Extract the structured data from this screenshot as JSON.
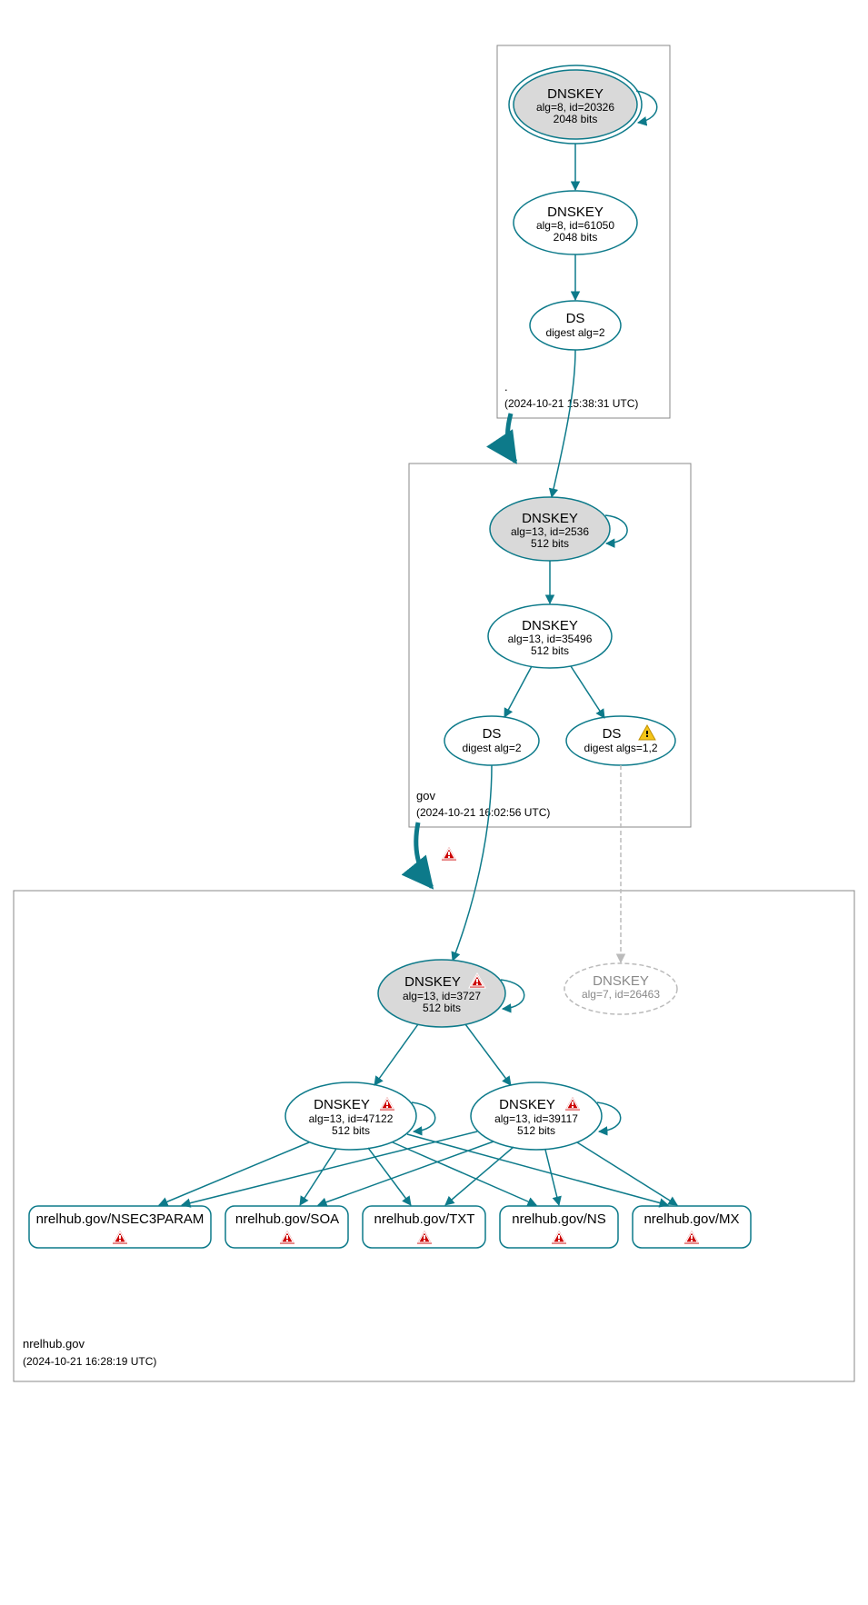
{
  "zones": {
    "root": {
      "label": ".",
      "timestamp": "(2024-10-21 15:38:31 UTC)"
    },
    "gov": {
      "label": "gov",
      "timestamp": "(2024-10-21 16:02:56 UTC)"
    },
    "nrelhub": {
      "label": "nrelhub.gov",
      "timestamp": "(2024-10-21 16:28:19 UTC)"
    }
  },
  "nodes": {
    "root_ksk": {
      "title": "DNSKEY",
      "line1": "alg=8, id=20326",
      "line2": "2048 bits"
    },
    "root_zsk": {
      "title": "DNSKEY",
      "line1": "alg=8, id=61050",
      "line2": "2048 bits"
    },
    "root_ds": {
      "title": "DS",
      "line1": "digest alg=2"
    },
    "gov_ksk": {
      "title": "DNSKEY",
      "line1": "alg=13, id=2536",
      "line2": "512 bits"
    },
    "gov_zsk": {
      "title": "DNSKEY",
      "line1": "alg=13, id=35496",
      "line2": "512 bits"
    },
    "gov_ds1": {
      "title": "DS",
      "line1": "digest alg=2"
    },
    "gov_ds2": {
      "title": "DS",
      "line1": "digest algs=1,2"
    },
    "nrelhub_ksk": {
      "title": "DNSKEY",
      "line1": "alg=13, id=3727",
      "line2": "512 bits"
    },
    "nrelhub_zsk1": {
      "title": "DNSKEY",
      "line1": "alg=13, id=47122",
      "line2": "512 bits"
    },
    "nrelhub_zsk2": {
      "title": "DNSKEY",
      "line1": "alg=13, id=39117",
      "line2": "512 bits"
    },
    "nrelhub_grey": {
      "title": "DNSKEY",
      "line1": "alg=7, id=26463"
    },
    "rr_nsec3param": {
      "label": "nrelhub.gov/NSEC3PARAM"
    },
    "rr_soa": {
      "label": "nrelhub.gov/SOA"
    },
    "rr_txt": {
      "label": "nrelhub.gov/TXT"
    },
    "rr_ns": {
      "label": "nrelhub.gov/NS"
    },
    "rr_mx": {
      "label": "nrelhub.gov/MX"
    }
  }
}
